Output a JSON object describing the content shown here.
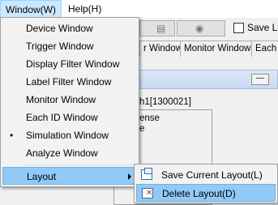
{
  "menubar": {
    "window_label": "Window(W)",
    "help_label": "Help(H)"
  },
  "toolbar": {
    "checkbox_label": "Save Lo"
  },
  "tabs": [
    {
      "label": "r Window"
    },
    {
      "label": "Monitor Window"
    },
    {
      "label": "Each I"
    }
  ],
  "panel": {
    "minimize_label": "—",
    "channel_text": "h1[1300021]",
    "line1": "ense",
    "line2": "e"
  },
  "window_menu": {
    "items": [
      {
        "label": "Device Window",
        "checked": false
      },
      {
        "label": "Trigger Window",
        "checked": false
      },
      {
        "label": "Display Filter Window",
        "checked": false
      },
      {
        "label": "Label Filter Window",
        "checked": false
      },
      {
        "label": "Monitor Window",
        "checked": false
      },
      {
        "label": "Each ID Window",
        "checked": false
      },
      {
        "label": "Simulation Window",
        "checked": true
      },
      {
        "label": "Analyze Window",
        "checked": false
      }
    ],
    "layout_label": "Layout",
    "bullet": "•"
  },
  "layout_submenu": {
    "items": [
      {
        "label": "Save Current Layout(L)",
        "icon": "save-layout-icon"
      },
      {
        "label": "Delete Layout(D)",
        "icon": "delete-layout-icon"
      }
    ]
  }
}
